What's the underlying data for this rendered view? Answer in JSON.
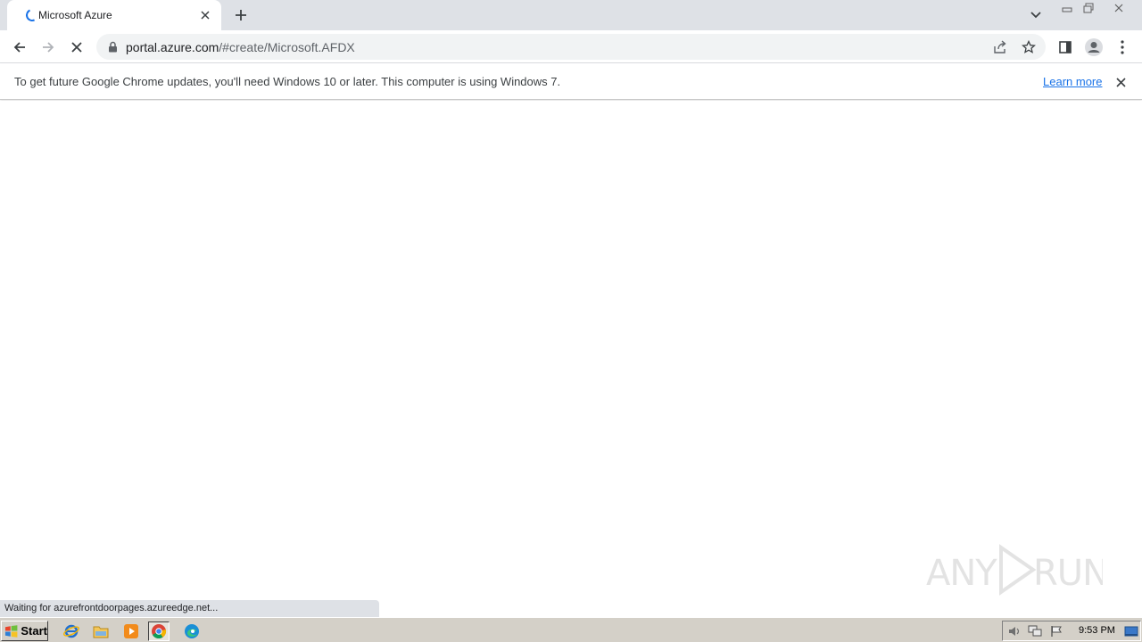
{
  "browser": {
    "tab": {
      "title": "Microsoft Azure"
    },
    "address": {
      "host": "portal.azure.com",
      "path": "/#create/Microsoft.AFDX"
    },
    "infobar": {
      "message": "To get future Google Chrome updates, you'll need Windows 10 or later. This computer is using Windows 7.",
      "link": "Learn more"
    },
    "status_text": "Waiting for azurefrontdoorpages.azureedge.net..."
  },
  "taskbar": {
    "start_label": "Start",
    "pinned_icons": [
      "internet-explorer-icon",
      "file-explorer-icon",
      "media-player-icon",
      "chrome-icon",
      "edge-icon"
    ],
    "clock": "9:53 PM"
  },
  "colors": {
    "tabstrip": "#dee1e6",
    "accent": "#1a73e8",
    "omnibox": "#f1f3f4",
    "taskbar": "#d4d0c8"
  }
}
